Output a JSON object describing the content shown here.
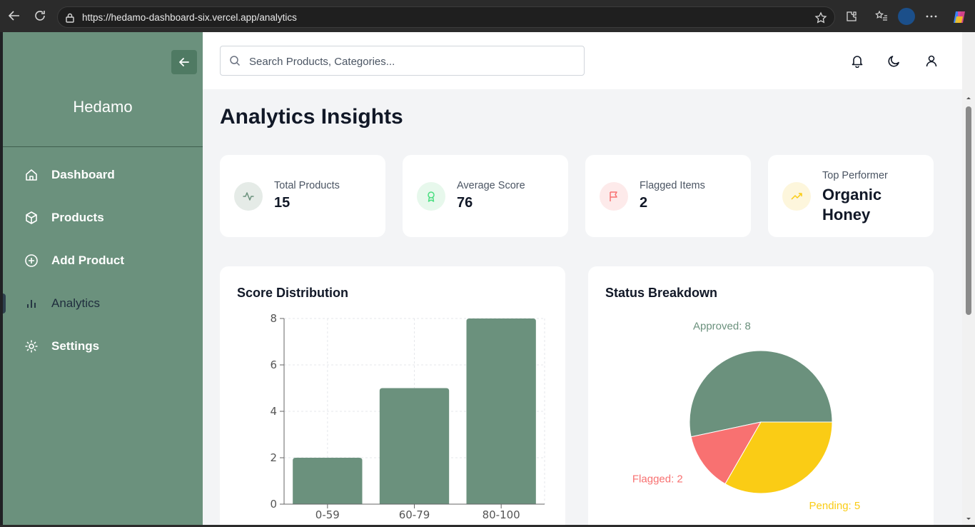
{
  "browser": {
    "url": "https://hedamo-dashboard-six.vercel.app/analytics"
  },
  "sidebar": {
    "brand": "Hedamo",
    "items": [
      {
        "label": "Dashboard",
        "icon": "home-icon"
      },
      {
        "label": "Products",
        "icon": "box-icon"
      },
      {
        "label": "Add Product",
        "icon": "plus-circle-icon"
      },
      {
        "label": "Analytics",
        "icon": "bar-chart-icon",
        "active": true
      },
      {
        "label": "Settings",
        "icon": "gear-icon"
      }
    ]
  },
  "topbar": {
    "search_placeholder": "Search Products, Categories..."
  },
  "main": {
    "title": "Analytics Insights",
    "stats": [
      {
        "label": "Total Products",
        "value": "15",
        "icon": "activity-icon",
        "color": "#6b917d"
      },
      {
        "label": "Average Score",
        "value": "76",
        "icon": "award-icon",
        "color": "#4ade80"
      },
      {
        "label": "Flagged Items",
        "value": "2",
        "icon": "flag-icon",
        "color": "#f87171"
      },
      {
        "label": "Top Performer",
        "value": "Organic Honey",
        "icon": "trending-up-icon",
        "color": "#facc15"
      }
    ],
    "score_panel": {
      "title": "Score Distribution"
    },
    "status_panel": {
      "title": "Status Breakdown"
    }
  },
  "chart_data": [
    {
      "type": "bar",
      "title": "Score Distribution",
      "categories": [
        "0-59",
        "60-79",
        "80-100"
      ],
      "values": [
        2,
        5,
        8
      ],
      "ylim": [
        0,
        8
      ],
      "yticks": [
        "0",
        "2",
        "4",
        "6",
        "8"
      ],
      "grid": true,
      "color": "#6b917d"
    },
    {
      "type": "pie",
      "title": "Status Breakdown",
      "slices": [
        {
          "label": "Approved: 8",
          "value": 8,
          "color": "#6b917d"
        },
        {
          "label": "Flagged: 2",
          "value": 2,
          "color": "#f87171"
        },
        {
          "label": "Pending: 5",
          "value": 5,
          "color": "#facc15"
        }
      ]
    }
  ]
}
